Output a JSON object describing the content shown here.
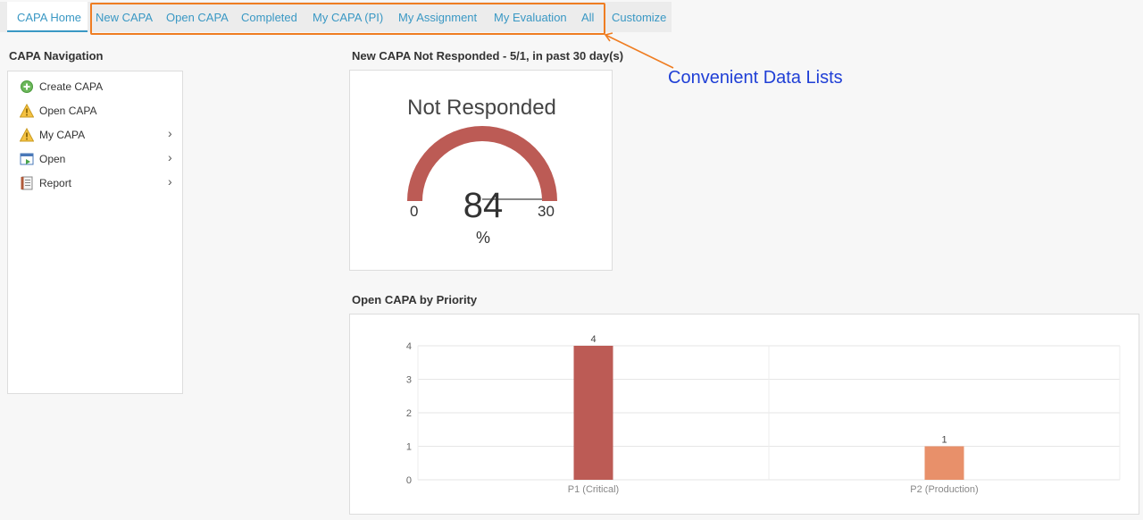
{
  "tabs": [
    {
      "label": "CAPA Home",
      "active": true
    },
    {
      "label": "New CAPA"
    },
    {
      "label": "Open CAPA"
    },
    {
      "label": "Completed"
    },
    {
      "label": "My CAPA (PI)"
    },
    {
      "label": "My Assignment"
    },
    {
      "label": "My Evaluation"
    },
    {
      "label": "All"
    },
    {
      "label": "Customize"
    }
  ],
  "annotation": {
    "text": "Convenient Data Lists",
    "box_color": "#ef7d22",
    "text_color": "#1f3fd6"
  },
  "navigation": {
    "title": "CAPA Navigation",
    "items": [
      {
        "label": "Create CAPA",
        "icon": "add-circle-icon",
        "has_submenu": false
      },
      {
        "label": "Open CAPA",
        "icon": "warning-icon",
        "has_submenu": false
      },
      {
        "label": "My CAPA",
        "icon": "warning-icon",
        "has_submenu": true
      },
      {
        "label": "Open",
        "icon": "open-window-icon",
        "has_submenu": true
      },
      {
        "label": "Report",
        "icon": "report-icon",
        "has_submenu": true
      }
    ],
    "chevron": "›"
  },
  "gauge": {
    "section_title": "New CAPA Not Responded - 5/1, in past 30 day(s)",
    "title": "Not Responded",
    "value": "84",
    "unit": "%",
    "min": "0",
    "max": "30",
    "color": "#bc5b55"
  },
  "priority_chart": {
    "section_title": "Open CAPA by Priority"
  },
  "chart_data": {
    "type": "bar",
    "categories": [
      "P1 (Critical)",
      "P2 (Production)"
    ],
    "values": [
      4,
      1
    ],
    "colors": [
      "#bc5b55",
      "#e8906a"
    ],
    "ylim": [
      0,
      4
    ],
    "yticks": [
      0,
      1,
      2,
      3,
      4
    ],
    "data_labels": [
      "4",
      "1"
    ],
    "grid": true,
    "title": "",
    "xlabel": "",
    "ylabel": ""
  }
}
